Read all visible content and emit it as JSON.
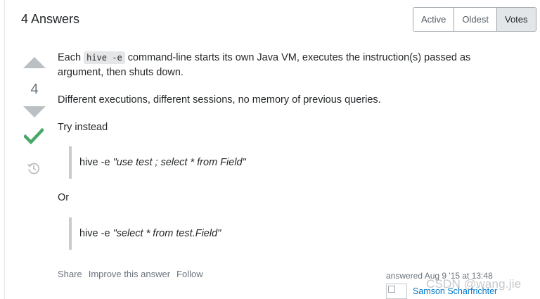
{
  "header": {
    "title": "4 Answers"
  },
  "sort_tabs": [
    {
      "label": "Active",
      "selected": false
    },
    {
      "label": "Oldest",
      "selected": false
    },
    {
      "label": "Votes",
      "selected": true
    }
  ],
  "vote": {
    "count": "4"
  },
  "answer": {
    "p1_before": "Each",
    "p1_code": "hive -e",
    "p1_after": "command-line starts its own Java VM, executes the instruction(s) passed as argument, then shuts down.",
    "p2": "Different executions, different sessions, no memory of previous queries.",
    "p3": "Try instead",
    "quote1_cmd": "hive -e ",
    "quote1_str": "\"use test ; select * from Field\"",
    "p4": "Or",
    "quote2_cmd": "hive -e ",
    "quote2_str": "\"select * from test.Field\""
  },
  "post_menu": {
    "share": "Share",
    "improve": "Improve this answer",
    "follow": "Follow"
  },
  "signature": {
    "action": "answered Aug 9 '15 at 13:48",
    "user": "Samson Scharfrichter"
  },
  "watermark": "CSDN @wang.jie",
  "colors": {
    "accepted": "#48a868",
    "vote_arrow": "#bbc0c4",
    "link": "#0077cc"
  }
}
